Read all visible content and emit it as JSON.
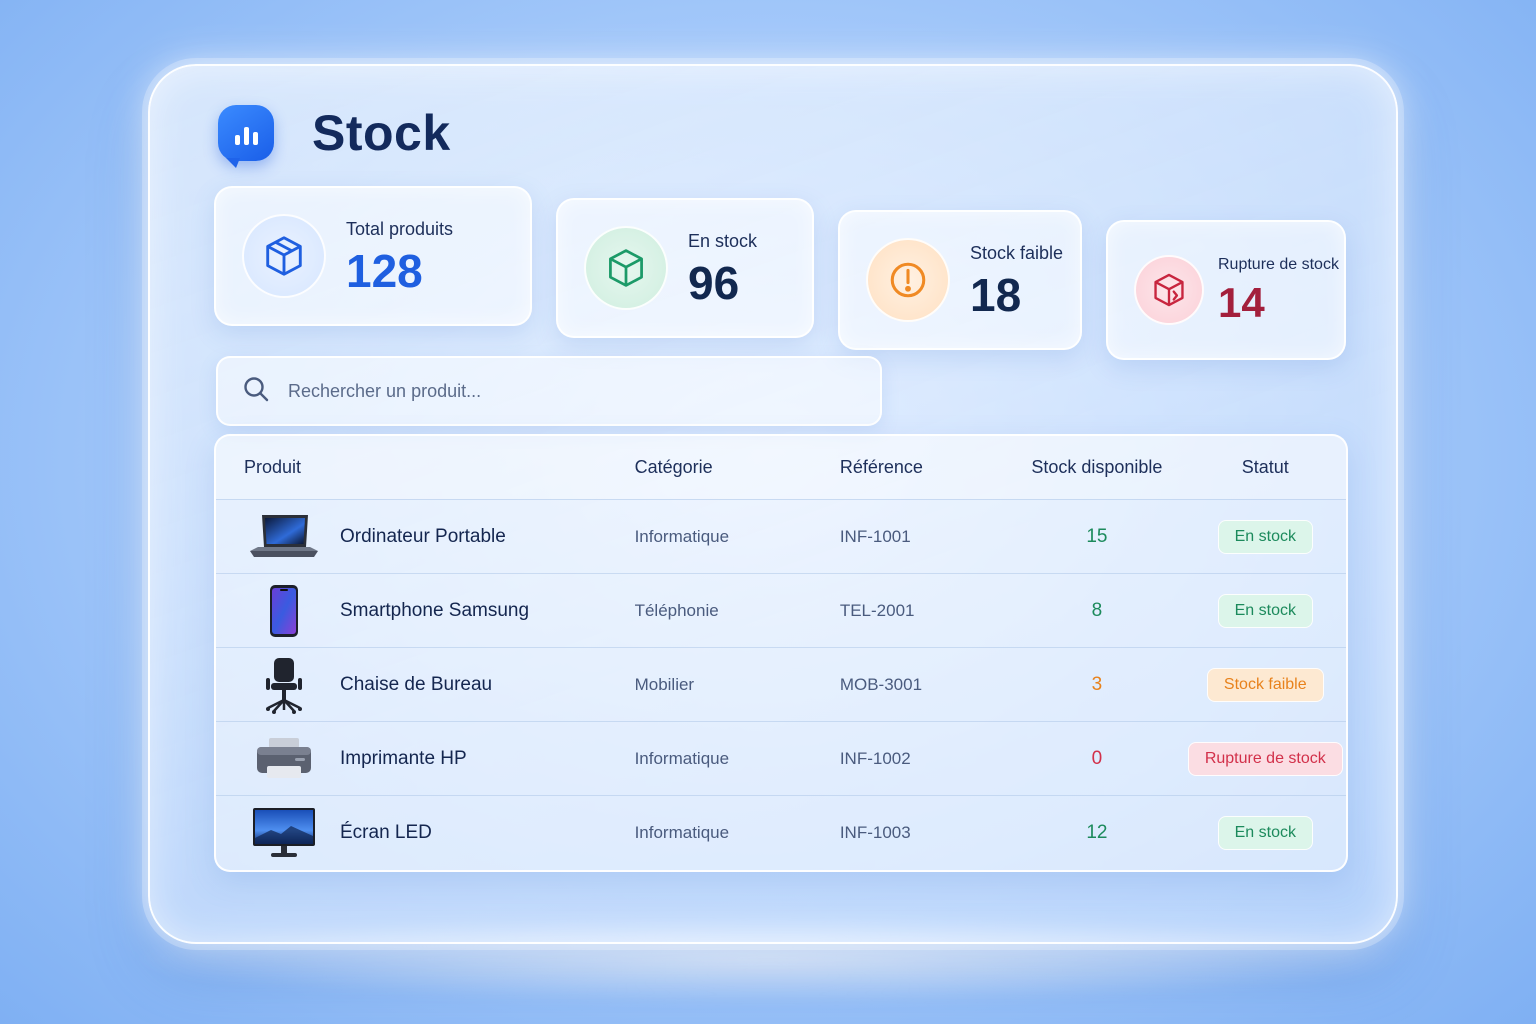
{
  "app": {
    "title": "Stock"
  },
  "stats": [
    {
      "label": "Total produits",
      "value": "128",
      "icon": "cube-icon",
      "color": "#1f5fe0"
    },
    {
      "label": "En stock",
      "value": "96",
      "icon": "box-icon",
      "color": "#1c9a68"
    },
    {
      "label": "Stock faible",
      "value": "18",
      "icon": "warning-icon",
      "color": "#f08a24"
    },
    {
      "label": "Rupture de stock",
      "value": "14",
      "icon": "broken-box-icon",
      "color": "#c8263f"
    }
  ],
  "search": {
    "placeholder": "Rechercher un produit..."
  },
  "table": {
    "columns": [
      "Produit",
      "Catégorie",
      "Référence",
      "Stock disponible",
      "Statut"
    ],
    "rows": [
      {
        "product": "Ordinateur Portable",
        "icon": "laptop-icon",
        "category": "Informatique",
        "reference": "INF-1001",
        "stock": "15",
        "status": "En stock"
      },
      {
        "product": "Smartphone Samsung",
        "icon": "smartphone-icon",
        "category": "Téléphonie",
        "reference": "TEL-2001",
        "stock": "8",
        "status": "En stock"
      },
      {
        "product": "Chaise de Bureau",
        "icon": "office-chair-icon",
        "category": "Mobilier",
        "reference": "MOB-3001",
        "stock": "3",
        "status": "Stock faible"
      },
      {
        "product": "Imprimante HP",
        "icon": "printer-icon",
        "category": "Informatique",
        "reference": "INF-1002",
        "stock": "0",
        "status": "Rupture de stock"
      },
      {
        "product": "Écran LED",
        "icon": "monitor-icon",
        "category": "Informatique",
        "reference": "INF-1003",
        "stock": "12",
        "status": "En stock"
      }
    ]
  },
  "status_colors": {
    "in_stock": {
      "text": "#1c8a5c",
      "bg": "#dcf5ea"
    },
    "low": {
      "text": "#e8821c",
      "bg": "#fde9d2"
    },
    "out": {
      "text": "#d2304a",
      "bg": "#fbdde3"
    }
  }
}
